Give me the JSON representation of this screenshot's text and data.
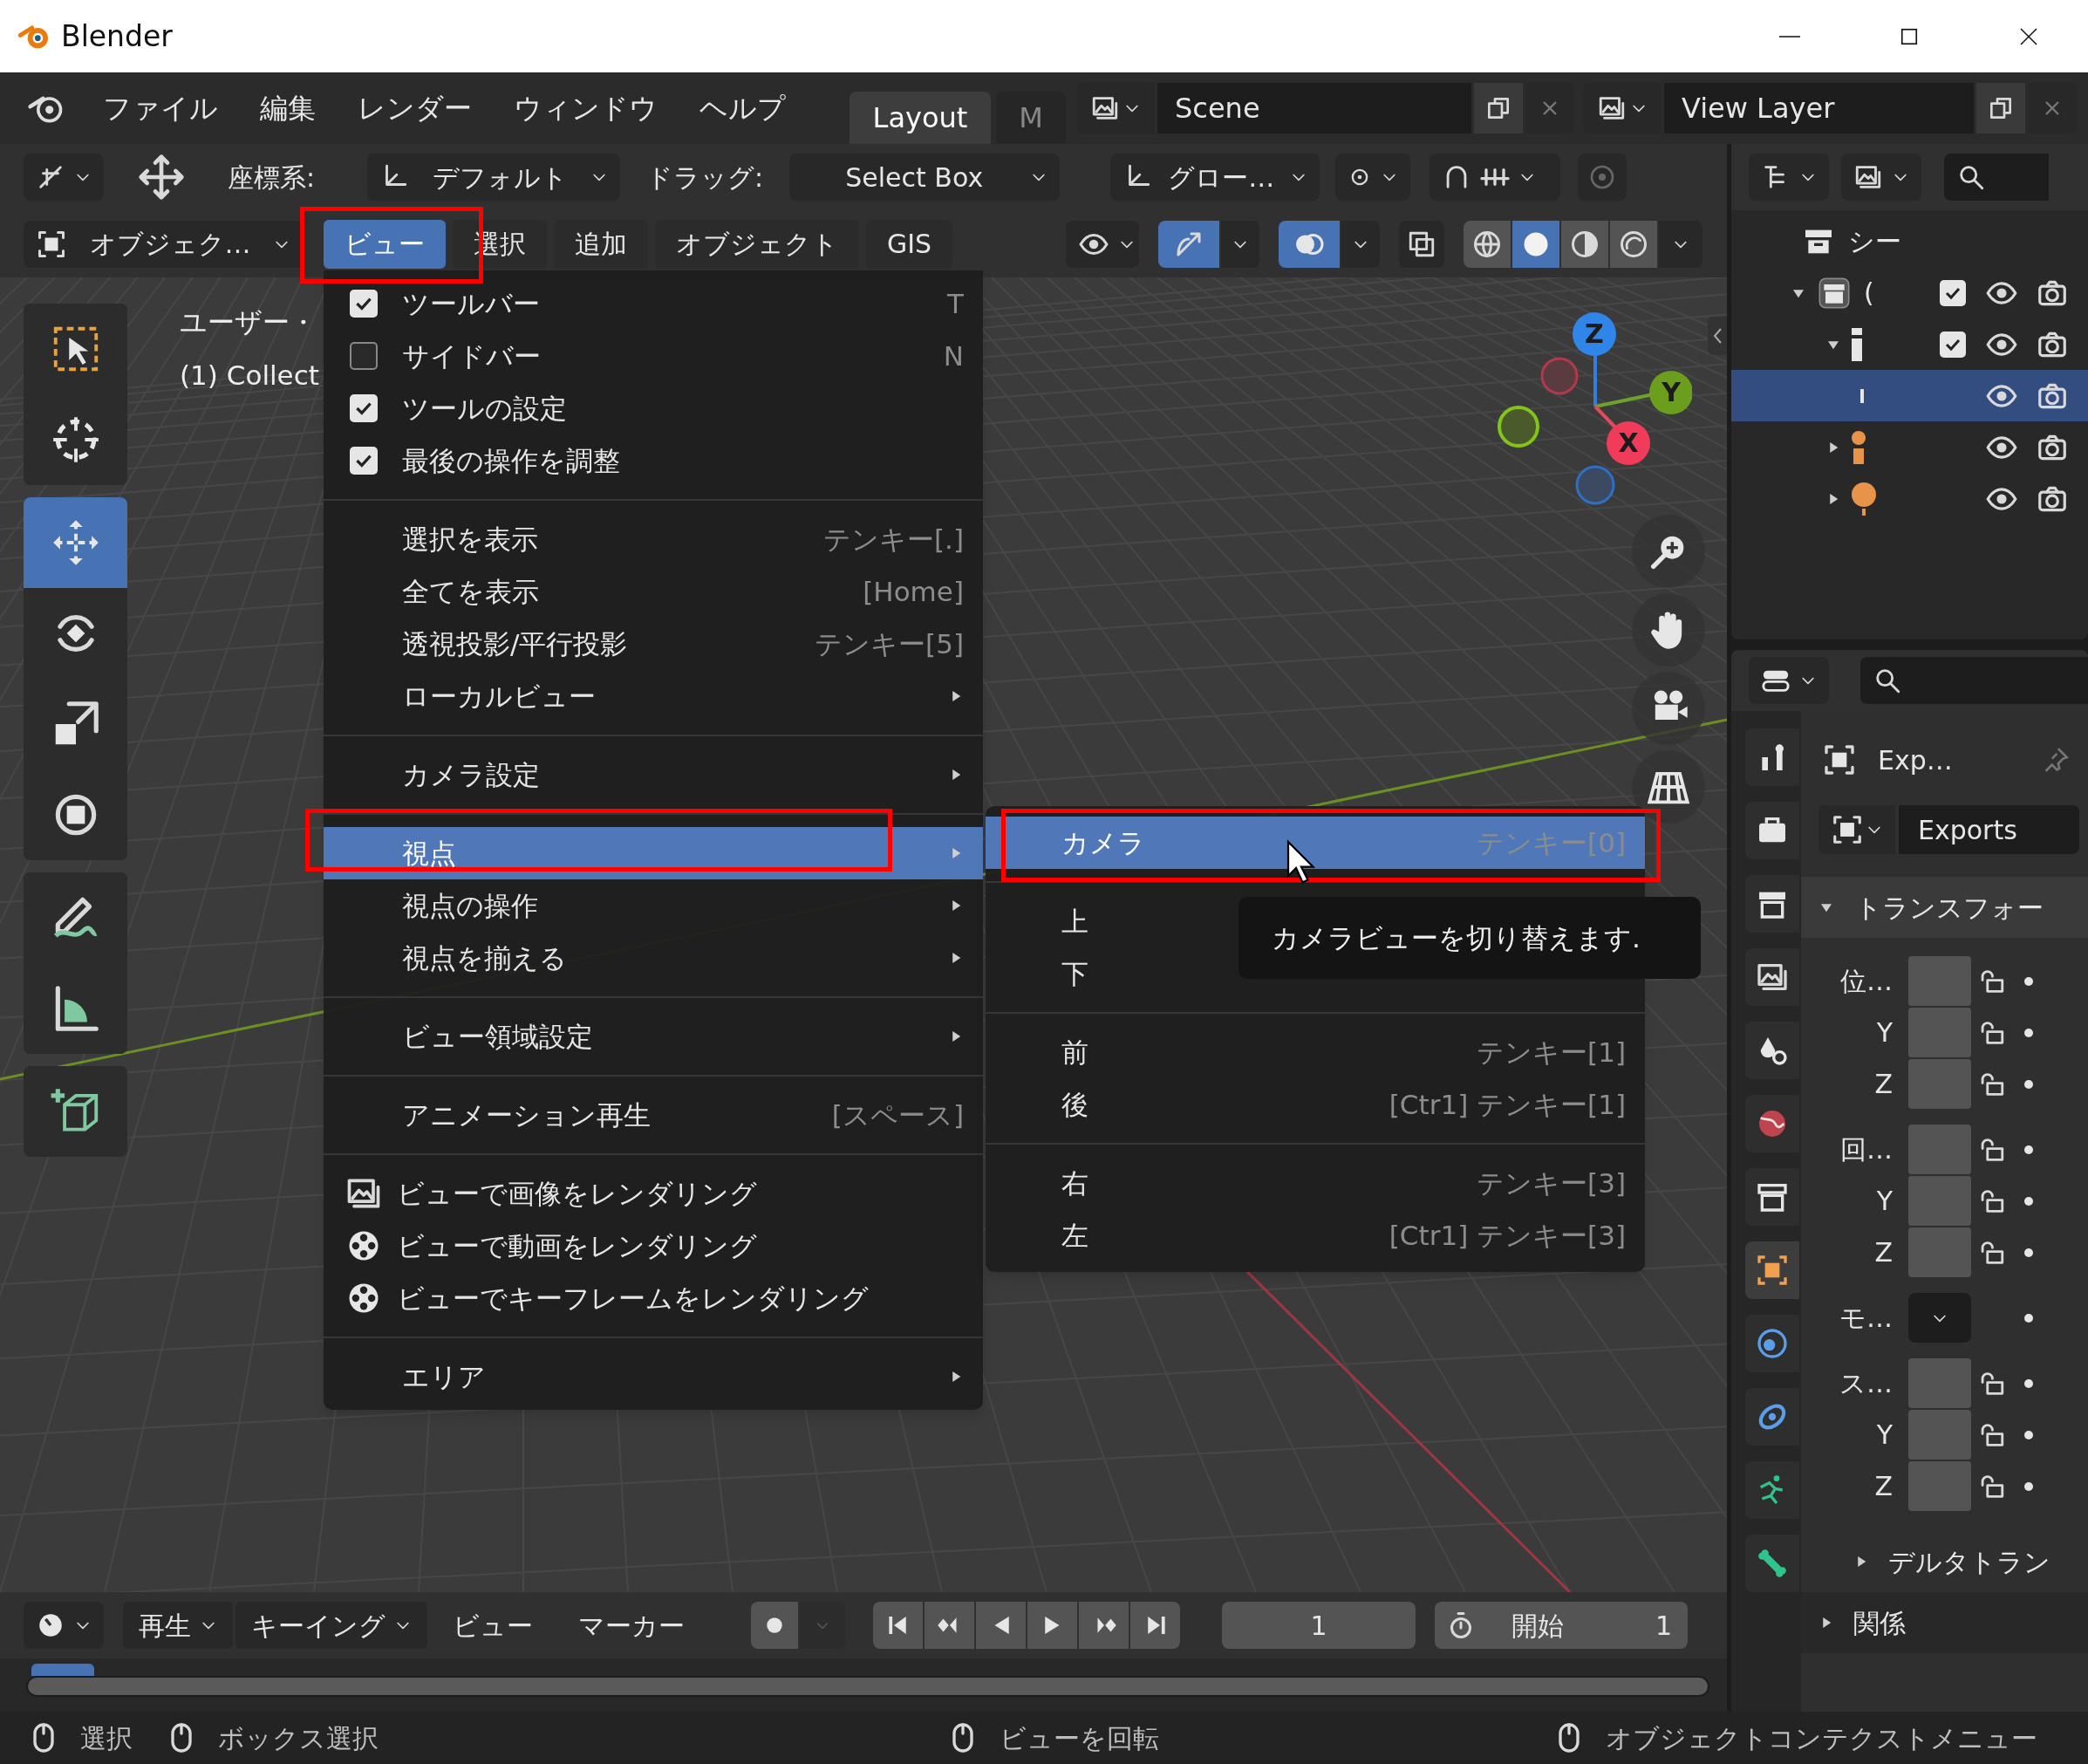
{
  "window": {
    "title": "Blender"
  },
  "menu_bar": [
    "ファイル",
    "編集",
    "レンダー",
    "ウィンドウ",
    "ヘルプ"
  ],
  "workspace_tabs": [
    {
      "label": "Layout",
      "selected": true
    },
    {
      "label": "M",
      "selected": false
    }
  ],
  "scene": "Scene",
  "view_layer": "View Layer",
  "tool_settings": {
    "orientation_label": "座標系:",
    "orientation": "デフォルト",
    "drag_label": "ドラッグ:",
    "drag": "Select Box",
    "transform_orientation": "グロー…",
    "snap_on": false
  },
  "viewport_header": {
    "mode": "オブジェク…",
    "menus": [
      {
        "label": "ビュー",
        "selected": true
      },
      {
        "label": "選択",
        "selected": false
      },
      {
        "label": "追加",
        "selected": false
      },
      {
        "label": "オブジェクト",
        "selected": false
      },
      {
        "label": "GIS",
        "selected": false
      }
    ],
    "gizmos_on": true,
    "overlays_on": true,
    "xray_on": false,
    "shading": [
      {
        "selected": false
      },
      {
        "selected": true
      },
      {
        "selected": false
      },
      {
        "selected": false
      }
    ]
  },
  "toolbar": [
    {
      "selected": false
    },
    {
      "selected": false
    },
    {
      "selected": true
    },
    {
      "selected": false
    },
    {
      "selected": false
    },
    {
      "selected": false
    },
    {
      "selected": false
    },
    {
      "selected": false
    },
    {
      "selected": false
    }
  ],
  "viewport": {
    "info": [
      "ユーザー・",
      "(1) Collect"
    ],
    "axes": [
      "Z",
      "Y",
      "X"
    ]
  },
  "view_menu": [
    {
      "kind": "check",
      "label": "ツールバー",
      "shortcut": "T",
      "checked": true,
      "selected": false
    },
    {
      "kind": "check",
      "label": "サイドバー",
      "shortcut": "N",
      "checked": false,
      "selected": false
    },
    {
      "kind": "check",
      "label": "ツールの設定",
      "checked": true,
      "selected": false
    },
    {
      "kind": "check",
      "label": "最後の操作を調整",
      "checked": true,
      "selected": false
    },
    {
      "kind": "separator"
    },
    {
      "kind": "item",
      "label": "選択を表示",
      "shortcut": "テンキー[.]",
      "selected": false
    },
    {
      "kind": "item",
      "label": "全てを表示",
      "shortcut": "[Home]",
      "selected": false
    },
    {
      "kind": "item",
      "label": "透視投影/平行投影",
      "shortcut": "テンキー[5]",
      "selected": false
    },
    {
      "kind": "submenu",
      "label": "ローカルビュー",
      "selected": false
    },
    {
      "kind": "separator"
    },
    {
      "kind": "submenu",
      "label": "カメラ設定",
      "selected": false
    },
    {
      "kind": "separator"
    },
    {
      "kind": "submenu",
      "label": "視点",
      "selected": true
    },
    {
      "kind": "submenu",
      "label": "視点の操作",
      "selected": false
    },
    {
      "kind": "submenu",
      "label": "視点を揃える",
      "selected": false
    },
    {
      "kind": "separator"
    },
    {
      "kind": "submenu",
      "label": "ビュー領域設定",
      "selected": false
    },
    {
      "kind": "separator"
    },
    {
      "kind": "item",
      "label": "アニメーション再生",
      "shortcut": "[スペース]",
      "selected": false
    },
    {
      "kind": "separator"
    },
    {
      "kind": "icon",
      "label": "ビューで画像をレンダリング",
      "selected": false
    },
    {
      "kind": "icon",
      "label": "ビューで動画をレンダリング",
      "selected": false
    },
    {
      "kind": "icon",
      "label": "ビューでキーフレームをレンダリング",
      "selected": false
    },
    {
      "kind": "separator"
    },
    {
      "kind": "submenu",
      "label": "エリア",
      "selected": false
    }
  ],
  "submenu": [
    {
      "kind": "item",
      "label": "カメラ",
      "shortcut": "テンキー[0]",
      "selected": true
    },
    {
      "kind": "separator"
    },
    {
      "kind": "item",
      "label": "上",
      "selected": false
    },
    {
      "kind": "item",
      "label": "下",
      "selected": false
    },
    {
      "kind": "separator"
    },
    {
      "kind": "item",
      "label": "前",
      "shortcut": "テンキー[1]",
      "selected": false
    },
    {
      "kind": "item",
      "label": "後",
      "shortcut": "[Ctr1] テンキー[1]",
      "selected": false
    },
    {
      "kind": "separator"
    },
    {
      "kind": "item",
      "label": "右",
      "shortcut": "テンキー[3]",
      "selected": false
    },
    {
      "kind": "item",
      "label": "左",
      "shortcut": "[Ctr1] テンキー[3]",
      "selected": false
    }
  ],
  "tooltip": "カメラビューを切り替えます.",
  "outliner": [
    {
      "kind": "scene_collection",
      "label": "シー",
      "selected": false,
      "children": [
        {
          "kind": "collection",
          "label": "(",
          "expanded": true,
          "checked": true,
          "selected": false,
          "children": [
            {
              "kind": "object",
              "expanded": true,
              "checked": true,
              "selected": false,
              "children": [
                {
                  "kind": "data",
                  "selected": true
                }
              ]
            },
            {
              "kind": "armature",
              "expanded": false,
              "selected": false
            },
            {
              "kind": "mesh",
              "expanded": false,
              "selected": false
            }
          ]
        }
      ]
    }
  ],
  "properties": {
    "tabs": [
      {
        "selected": false
      },
      {
        "selected": false
      },
      {
        "selected": false
      },
      {
        "selected": false
      },
      {
        "selected": false
      },
      {
        "selected": false
      },
      {
        "selected": false
      },
      {
        "selected": true
      },
      {
        "selected": false
      },
      {
        "selected": false
      },
      {
        "selected": false
      },
      {
        "selected": false
      }
    ],
    "object": "Exp…",
    "data": "Exports",
    "section": "トランスフォー",
    "fields": [
      {
        "kind": "vector",
        "label": "位…"
      },
      {
        "kind": "vector",
        "label": "Y"
      },
      {
        "kind": "vector",
        "label": "Z"
      },
      {
        "kind": "vector",
        "label": "回…"
      },
      {
        "kind": "vector",
        "label": "Y"
      },
      {
        "kind": "vector",
        "label": "Z"
      },
      {
        "kind": "dropdown",
        "label": "モ…"
      },
      {
        "kind": "vector",
        "label": "ス…"
      },
      {
        "kind": "vector",
        "label": "Y"
      },
      {
        "kind": "vector",
        "label": "Z"
      }
    ],
    "subsections": [
      "デルタトラン",
      "関係"
    ]
  },
  "timeline": {
    "menus": [
      {
        "kind": "dropdown",
        "label": "再生"
      },
      {
        "kind": "dropdown",
        "label": "キーイング"
      },
      {
        "kind": "plain",
        "label": "ビュー"
      },
      {
        "kind": "plain",
        "label": "マーカー"
      }
    ],
    "frame": "1",
    "start_label": "開始",
    "start": "1"
  },
  "status_bar": [
    "選択",
    "ボックス選択",
    "ビューを回転",
    "オブジェクトコンテクストメニュー"
  ]
}
